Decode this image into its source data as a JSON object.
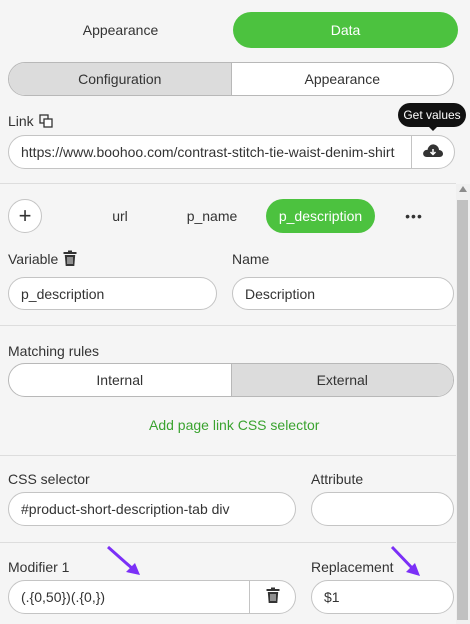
{
  "top_tabs": [
    {
      "label": "Appearance",
      "active": false
    },
    {
      "label": "Data",
      "active": true
    }
  ],
  "segment_top": {
    "options": [
      "Configuration",
      "Appearance"
    ],
    "selected": "Configuration"
  },
  "link": {
    "label": "Link",
    "value": "https://www.boohoo.com/contrast-stitch-tie-waist-denim-shirt",
    "tooltip": "Get values"
  },
  "variable_tabs": {
    "add_label": "+",
    "items": [
      "url",
      "p_name",
      "p_description"
    ],
    "active": "p_description",
    "more_label": "•••"
  },
  "variable": {
    "label": "Variable",
    "value": "p_description"
  },
  "name": {
    "label": "Name",
    "value": "Description"
  },
  "matching_rules": {
    "label": "Matching rules",
    "options": [
      "Internal",
      "External"
    ],
    "selected": "External"
  },
  "add_selector_link": "Add page link CSS selector",
  "css_selector": {
    "label": "CSS selector",
    "value": "#product-short-description-tab div"
  },
  "attribute": {
    "label": "Attribute",
    "value": ""
  },
  "modifier": {
    "label": "Modifier 1",
    "value": "(.{0,50})(.{0,})"
  },
  "replacement": {
    "label": "Replacement",
    "value": "$1"
  },
  "colors": {
    "accent": "#4cc23f",
    "link_green": "#3aa32f",
    "annotation_arrow": "#7b2ff7"
  }
}
